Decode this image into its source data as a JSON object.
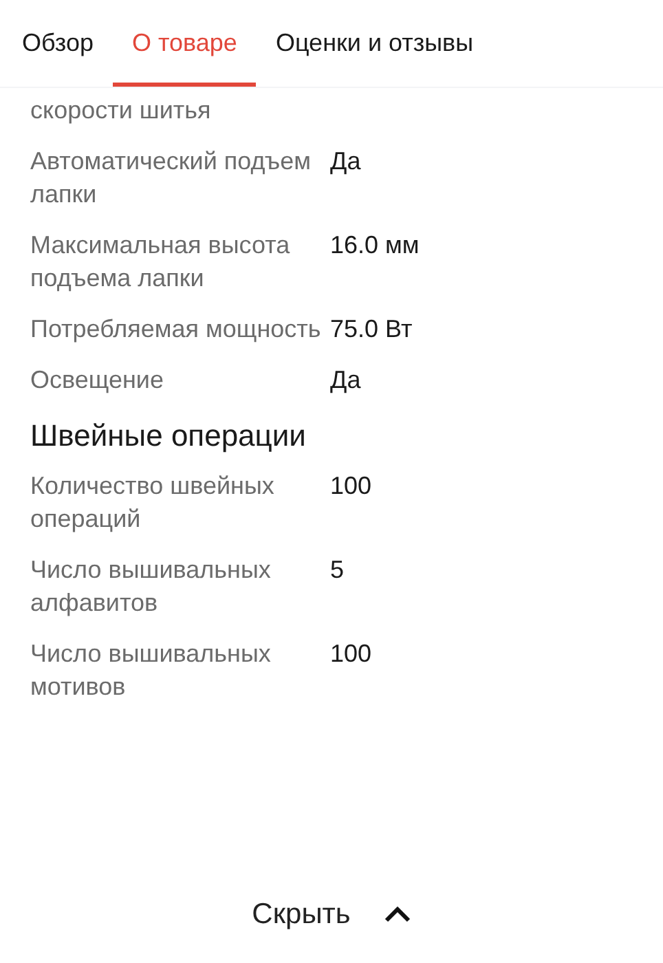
{
  "tabs": [
    {
      "label": "Обзор",
      "selected": false
    },
    {
      "label": "О товаре",
      "selected": true
    },
    {
      "label": "Оценки и отзывы",
      "selected": false
    }
  ],
  "specs": [
    {
      "kind": "row",
      "label": "скорости шитья"
    },
    {
      "kind": "row",
      "label": "Автоматический подъем лапки",
      "value": "Да"
    },
    {
      "kind": "row",
      "label": "Максимальная высота подъема лапки",
      "value": "16.0 мм"
    },
    {
      "kind": "row",
      "label": "Потребляемая мощность",
      "value": "75.0 Вт"
    },
    {
      "kind": "row",
      "label": "Освещение",
      "value": "Да"
    },
    {
      "kind": "heading",
      "label": "Швейные операции"
    },
    {
      "kind": "row",
      "label": "Количество швейных операций",
      "value": "100"
    },
    {
      "kind": "row",
      "label": "Число вышивальных алфавитов",
      "value": "5"
    },
    {
      "kind": "row",
      "label": "Число вышивальных мотивов",
      "value": "100"
    }
  ],
  "hide_button": {
    "label": "Скрыть"
  }
}
